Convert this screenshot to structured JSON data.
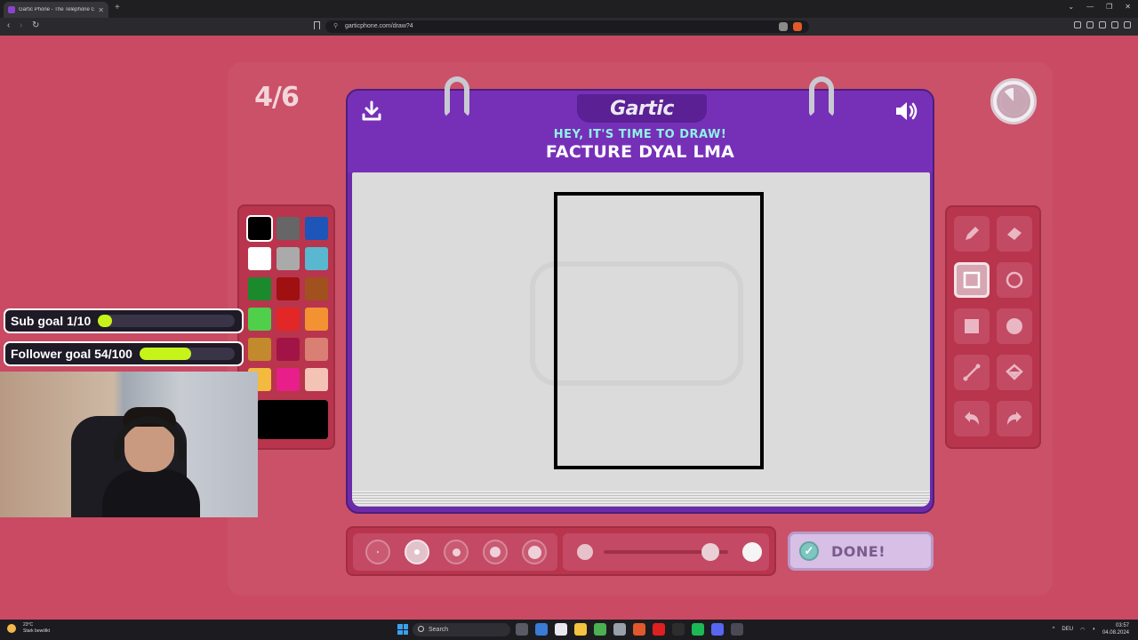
{
  "browser": {
    "tab_title": "Gartic Phone - The Telephone Game",
    "url": "garticphone.com/draw?4",
    "new_tab_label": "+",
    "window_controls": [
      "⌄",
      "—",
      "❐",
      "✕"
    ]
  },
  "game": {
    "round": "4/6",
    "logo": "Gartic",
    "prompt_subtitle": "HEY, IT'S TIME TO DRAW!",
    "prompt": "FACTURE DYAL LMA",
    "done_label": "DONE!",
    "timer_progress": 0.88,
    "palette": {
      "colors": [
        "#000000",
        "#666666",
        "#1d55b8",
        "#ffffff",
        "#aaaaaa",
        "#5ab7d0",
        "#1b8a2c",
        "#a01010",
        "#a0511e",
        "#4fcf4a",
        "#e32626",
        "#f39233",
        "#c28a2c",
        "#a31446",
        "#d97f74",
        "#f2ba3f",
        "#e81e8a",
        "#f5c3b5"
      ],
      "selected_index": 0,
      "current_color": "#000000"
    },
    "tools": [
      "pencil",
      "eraser",
      "rectangle-outline",
      "ellipse-outline",
      "rectangle-filled",
      "ellipse-filled",
      "line",
      "fill-bucket",
      "undo",
      "redo"
    ],
    "selected_tool": "rectangle-outline",
    "brush_sizes": 5,
    "selected_brush_size": 1,
    "opacity": 0.86
  },
  "overlay": {
    "sub_goal_label": "Sub goal 1/10",
    "sub_goal_progress": 0.1,
    "follower_goal_label": "Follower goal 54/100",
    "follower_goal_progress": 0.54
  },
  "taskbar": {
    "weather_temp": "23°C",
    "weather_desc": "Stark bewölkt",
    "search_placeholder": "Search",
    "language": "DEU",
    "time": "03:57",
    "date": "04.08.2024"
  }
}
